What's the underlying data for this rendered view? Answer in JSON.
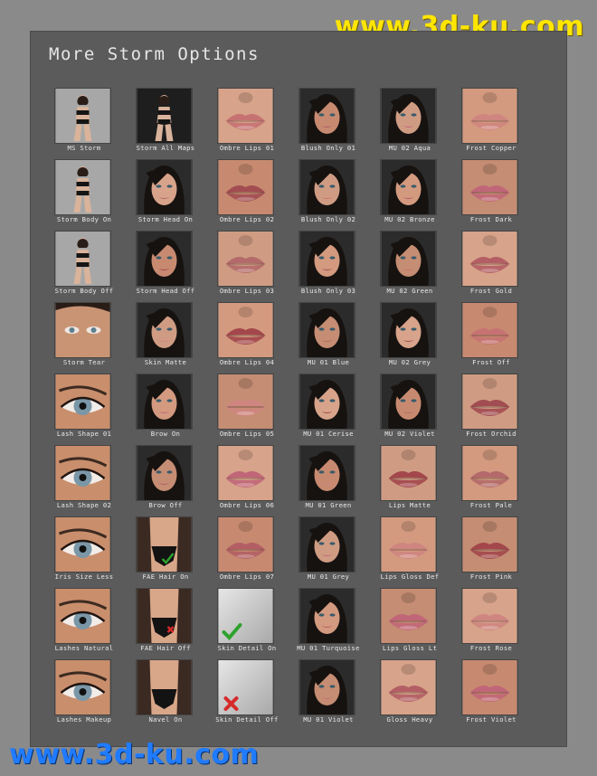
{
  "watermark": {
    "top": "www.3d-ku.com",
    "bottom": "www.3d-ku.com"
  },
  "panel": {
    "title": "More Storm Options"
  },
  "tiles": [
    {
      "label": "MS Storm",
      "icon": "figure-full-icon"
    },
    {
      "label": "Storm All Maps",
      "icon": "figure-full-icon"
    },
    {
      "label": "Ombre Lips 01",
      "icon": "lips-icon"
    },
    {
      "label": "Blush Only 01",
      "icon": "face-icon"
    },
    {
      "label": "MU 02 Aqua",
      "icon": "face-icon"
    },
    {
      "label": "Frost Copper",
      "icon": "lips-icon"
    },
    {
      "label": "Storm Body On",
      "icon": "figure-full-icon"
    },
    {
      "label": "Storm Head On",
      "icon": "face-icon"
    },
    {
      "label": "Ombre Lips 02",
      "icon": "lips-icon"
    },
    {
      "label": "Blush Only 02",
      "icon": "face-icon"
    },
    {
      "label": "MU 02 Bronze",
      "icon": "face-icon"
    },
    {
      "label": "Frost Dark",
      "icon": "lips-icon"
    },
    {
      "label": "Storm Body Off",
      "icon": "figure-full-icon"
    },
    {
      "label": "Storm Head Off",
      "icon": "face-icon"
    },
    {
      "label": "Ombre Lips 03",
      "icon": "lips-icon"
    },
    {
      "label": "Blush Only 03",
      "icon": "face-icon"
    },
    {
      "label": "MU 02 Green",
      "icon": "face-icon"
    },
    {
      "label": "Frost Gold",
      "icon": "lips-icon"
    },
    {
      "label": "Storm Tear",
      "icon": "eyes-icon"
    },
    {
      "label": "Skin Matte",
      "icon": "face-icon"
    },
    {
      "label": "Ombre Lips 04",
      "icon": "lips-icon"
    },
    {
      "label": "MU 01 Blue",
      "icon": "face-icon"
    },
    {
      "label": "MU 02 Grey",
      "icon": "face-icon"
    },
    {
      "label": "Frost Off",
      "icon": "lips-icon"
    },
    {
      "label": "Lash Shape 01",
      "icon": "eye-icon"
    },
    {
      "label": "Brow On",
      "icon": "face-icon"
    },
    {
      "label": "Ombre Lips 05",
      "icon": "lips-icon"
    },
    {
      "label": "MU 01 Cerise",
      "icon": "face-icon"
    },
    {
      "label": "MU 02 Violet",
      "icon": "face-icon"
    },
    {
      "label": "Frost Orchid",
      "icon": "lips-icon"
    },
    {
      "label": "Lash Shape 02",
      "icon": "eye-icon"
    },
    {
      "label": "Brow Off",
      "icon": "face-icon"
    },
    {
      "label": "Ombre Lips 06",
      "icon": "lips-icon"
    },
    {
      "label": "MU 01 Green",
      "icon": "face-icon"
    },
    {
      "label": "Lips Matte",
      "icon": "lips-icon"
    },
    {
      "label": "Frost Pale",
      "icon": "lips-icon"
    },
    {
      "label": "Iris Size Less",
      "icon": "eye-icon"
    },
    {
      "label": "FAE Hair On",
      "icon": "torso-check-icon"
    },
    {
      "label": "Ombre Lips 07",
      "icon": "lips-icon"
    },
    {
      "label": "MU 01 Grey",
      "icon": "face-icon"
    },
    {
      "label": "Lips Gloss Def",
      "icon": "lips-icon"
    },
    {
      "label": "Frost Pink",
      "icon": "lips-icon"
    },
    {
      "label": "Lashes Natural",
      "icon": "eye-icon"
    },
    {
      "label": "FAE Hair Off",
      "icon": "torso-cross-icon"
    },
    {
      "label": "Skin Detail On",
      "icon": "checkmark-icon"
    },
    {
      "label": "MU 01 Turquoise",
      "icon": "face-icon"
    },
    {
      "label": "Lips Gloss Lt",
      "icon": "lips-icon"
    },
    {
      "label": "Frost Rose",
      "icon": "lips-icon"
    },
    {
      "label": "Lashes Makeup",
      "icon": "eye-icon"
    },
    {
      "label": "Navel On",
      "icon": "torso-icon"
    },
    {
      "label": "Skin Detail Off",
      "icon": "cross-icon"
    },
    {
      "label": "MU 01 Violet",
      "icon": "face-icon"
    },
    {
      "label": "Gloss Heavy",
      "icon": "lips-icon"
    },
    {
      "label": "Frost Violet",
      "icon": "lips-icon"
    }
  ],
  "colors": {
    "background": "#8a8a8a",
    "panel": "#5b5b5b",
    "label_text": "#e9e9e9",
    "watermark_top": "#ffe600",
    "watermark_bottom": "#1f7bff",
    "check_green": "#2fa12f",
    "cross_red": "#d62a2a"
  }
}
